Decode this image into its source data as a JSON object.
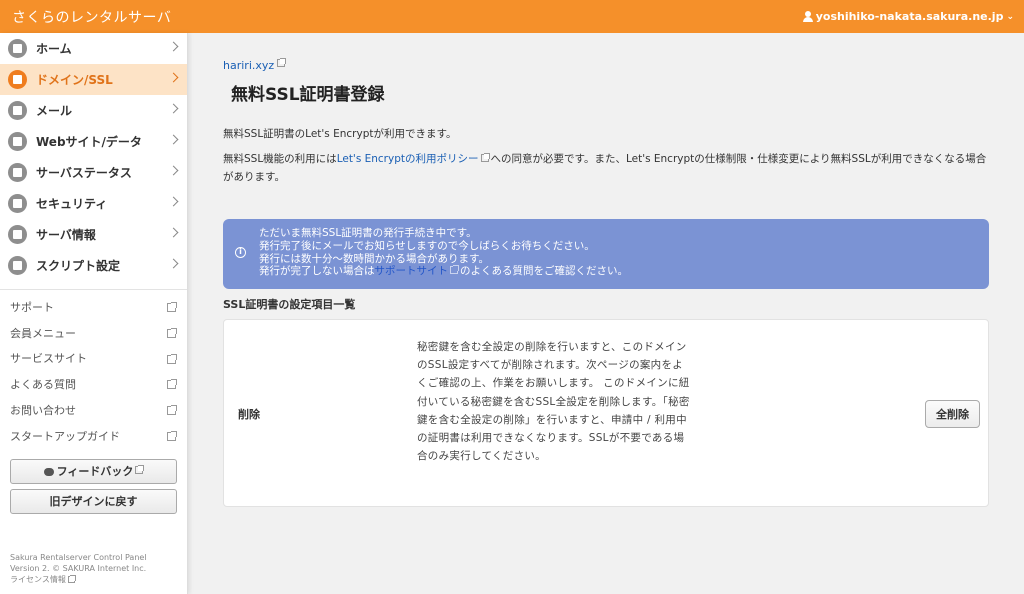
{
  "header": {
    "brand": "さくらのレンタルサーバ",
    "user": "yoshihiko-nakata.sakura.ne.jp",
    "caret": "⌄"
  },
  "sidebar": {
    "nav": [
      {
        "label": "ホーム",
        "icon": "home-icon"
      },
      {
        "label": "ドメイン/SSL",
        "icon": "domain-icon",
        "active": true
      },
      {
        "label": "メール",
        "icon": "mail-icon"
      },
      {
        "label": "Webサイト/データ",
        "icon": "globe-icon"
      },
      {
        "label": "サーバステータス",
        "icon": "chart-icon"
      },
      {
        "label": "セキュリティ",
        "icon": "lock-icon"
      },
      {
        "label": "サーバ情報",
        "icon": "server-icon"
      },
      {
        "label": "スクリプト設定",
        "icon": "script-icon"
      }
    ],
    "links": [
      {
        "label": "サポート"
      },
      {
        "label": "会員メニュー"
      },
      {
        "label": "サービスサイト"
      },
      {
        "label": "よくある質問"
      },
      {
        "label": "お問い合わせ"
      },
      {
        "label": "スタートアップガイド"
      }
    ],
    "feedback_label": "フィードバック",
    "old_design_label": "旧デザインに戻す",
    "footer_line1": "Sakura Rentalserver Control Panel",
    "footer_line2": "Version 2. © SAKURA Internet Inc.",
    "license_label": "ライセンス情報"
  },
  "main": {
    "domain": "hariri.xyz",
    "title": "無料SSL証明書登録",
    "intro1": "無料SSL証明書のLet's Encryptが利用できます。",
    "intro2_pre": "無料SSL機能の利用には",
    "intro2_link": "Let's Encryptの利用ポリシー",
    "intro2_post": "への同意が必要です。また、Let's Encryptの仕様制限・仕様変更により無料SSLが利用できなくなる場合があります。",
    "notice": {
      "line1": "ただいま無料SSL証明書の発行手続き中です。",
      "line2": "発行完了後にメールでお知らせしますので今しばらくお待ちください。",
      "line3": "発行には数十分〜数時間かかる場合があります。",
      "line4_pre": "発行が完了しない場合は",
      "line4_link": "サポートサイト",
      "line4_post": "のよくある質問をご確認ください。"
    },
    "section_heading": "SSL証明書の設定項目一覧",
    "row": {
      "label": "削除",
      "description": "秘密鍵を含む全設定の削除を行いますと、このドメインのSSL設定すべてが削除されます。次ページの案内をよくご確認の上、作業をお願いします。 このドメインに紐付いている秘密鍵を含むSSL全設定を削除します。「秘密鍵を含む全設定の削除」を行いますと、申請中 / 利用中の証明書は利用できなくなります。SSLが不要である場合のみ実行してください。",
      "button": "全削除"
    }
  },
  "colors": {
    "header": "#f5902a",
    "active_nav_bg": "#fde3c6",
    "notice_bg": "#7b93d4",
    "link": "#1a5fb4"
  }
}
